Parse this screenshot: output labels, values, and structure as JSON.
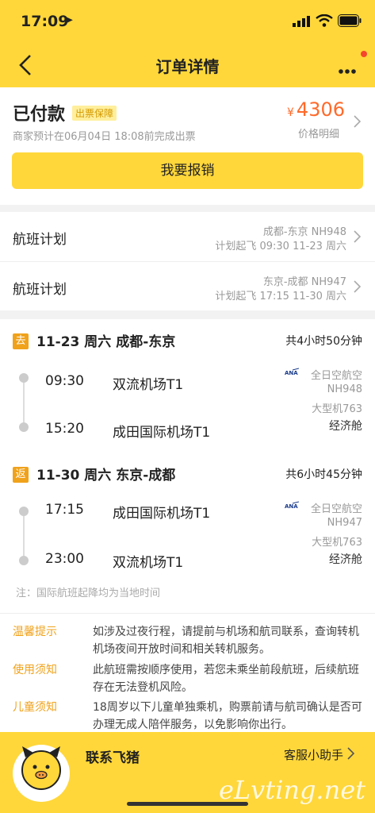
{
  "status_bar": {
    "time": "17:09",
    "location_glyph": "➤"
  },
  "nav": {
    "title": "订单详情"
  },
  "order": {
    "status": "已付款",
    "badge": "出票保障",
    "eta": "商家预计在06月04日 18:08前完成出票",
    "currency": "¥",
    "price": "4306",
    "price_detail": "价格明细",
    "reimburse_button": "我要报销"
  },
  "plans": [
    {
      "label": "航班计划",
      "route": "成都-东京 NH948",
      "time": "计划起飞 09:30 11-23 周六"
    },
    {
      "label": "航班计划",
      "route": "东京-成都 NH947",
      "time": "计划起飞 17:15 11-30 周六"
    }
  ],
  "segments": [
    {
      "tag": "去",
      "route": "11-23 周六 成都-东京",
      "duration": "共4小时50分钟",
      "dep_time": "09:30",
      "dep_airport": "双流机场T1",
      "arr_time": "15:20",
      "arr_airport": "成田国际机场T1",
      "airline": "全日空航空",
      "flight_no": "NH948",
      "plane": "大型机763",
      "cabin": "经济舱"
    },
    {
      "tag": "返",
      "route": "11-30 周六 东京-成都",
      "duration": "共6小时45分钟",
      "dep_time": "17:15",
      "dep_airport": "成田国际机场T1",
      "arr_time": "23:00",
      "arr_airport": "双流机场T1",
      "airline": "全日空航空",
      "flight_no": "NH947",
      "plane": "大型机763",
      "cabin": "经济舱"
    }
  ],
  "note": "注：国际航班起降均为当地时间",
  "tips": [
    {
      "key": "温馨提示",
      "text": "如涉及过夜行程，请提前与机场和航司联系，查询转机机场夜间开放时间和相关转机服务。"
    },
    {
      "key": "使用须知",
      "text": "此航班需按顺序使用，若您未乘坐前段航班，后续航班存在无法登机风险。"
    },
    {
      "key": "儿童须知",
      "text": "18周岁以下儿童单独乘机，购票前请与航司确认是否可办理无成人陪伴服务，以免影响你出行。"
    }
  ],
  "footer": {
    "contact": "联系飞猪",
    "assistant": "客服小助手",
    "watermark": "eLvting.net"
  },
  "colors": {
    "brand_yellow": "#ffd73a",
    "price_orange": "#ff6a2a",
    "tag_orange": "#f0a21b"
  }
}
